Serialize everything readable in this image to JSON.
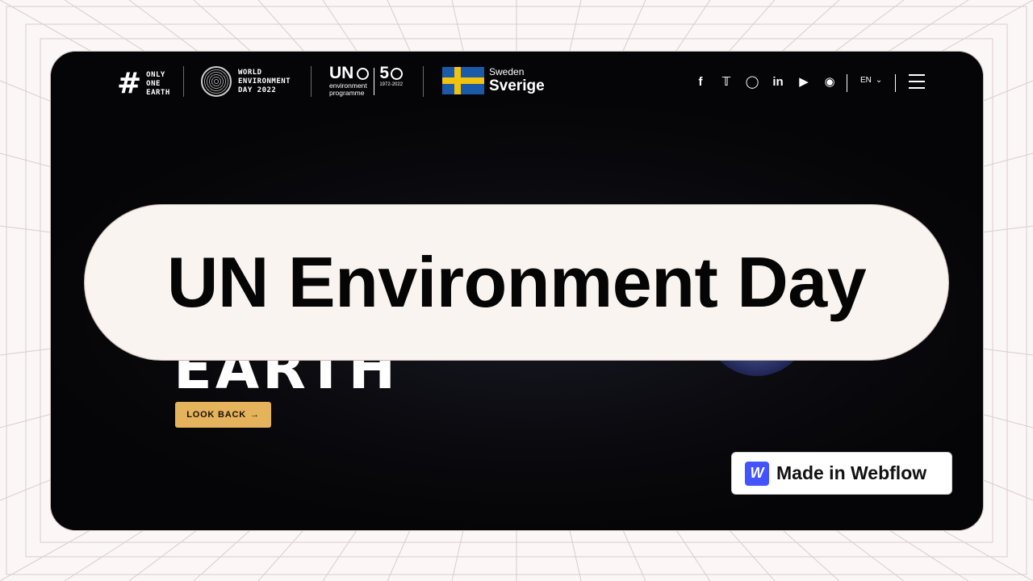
{
  "nav": {
    "brand_hash": "#",
    "brand_lines": [
      "ONLY",
      "ONE",
      "EARTH"
    ],
    "wed_lines": [
      "WORLD",
      "ENVIRONMENT",
      "DAY 2022"
    ],
    "un_word": "UN",
    "un_sub_lines": [
      "environment",
      "programme"
    ],
    "fifty_digit": "5",
    "fifty_years": "1972-2022",
    "sweden_small": "Sweden",
    "sweden_large": "Sverige",
    "social_icons": [
      "facebook-icon",
      "twitter-icon",
      "instagram-icon",
      "linkedin-icon",
      "youtube-icon",
      "weibo-icon"
    ],
    "language": "EN"
  },
  "hero": {
    "word": "EARTH",
    "look_back_label": "LOOK BACK",
    "look_back_arrow": "→"
  },
  "overlay": {
    "title": "UN Environment Day"
  },
  "badge": {
    "logo_letter": "W",
    "label": "Made in Webflow"
  },
  "colors": {
    "accent_button": "#e4b35c",
    "webflow_blue": "#4353ff",
    "sweden_blue": "#1b5aa8",
    "sweden_yellow": "#f1c30f"
  }
}
